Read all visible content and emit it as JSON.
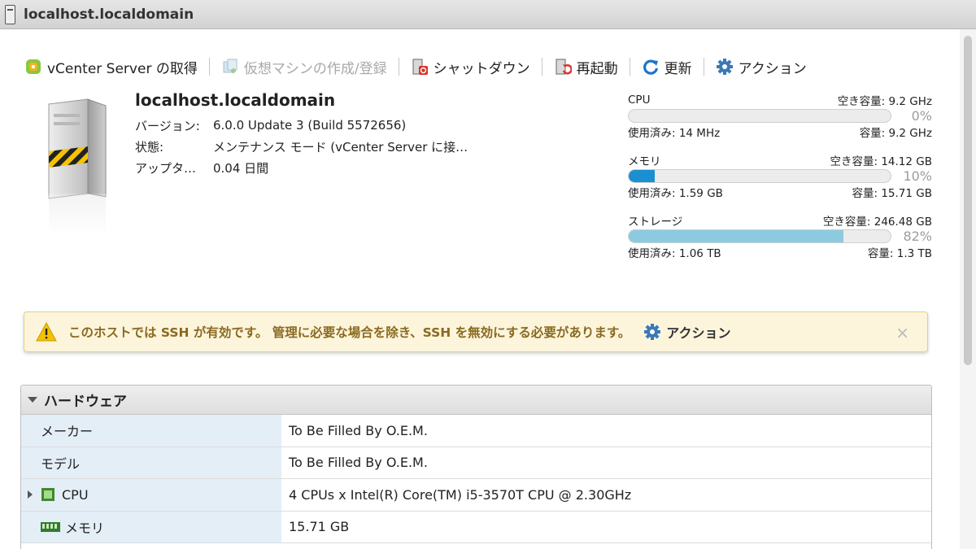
{
  "window": {
    "title": "localhost.localdomain"
  },
  "toolbar": {
    "vcenter_label": "vCenter Server の取得",
    "create_vm_label": "仮想マシンの作成/登録",
    "shutdown_label": "シャットダウン",
    "reboot_label": "再起動",
    "refresh_label": "更新",
    "actions_label": "アクション"
  },
  "host": {
    "name": "localhost.localdomain",
    "rows": [
      {
        "label": "バージョン:",
        "value": "6.0.0 Update 3 (Build 5572656)"
      },
      {
        "label": "状態:",
        "value": "メンテナンス モード (vCenter Server に接…"
      },
      {
        "label": "アップタ…",
        "value": "0.04 日間"
      }
    ]
  },
  "resources": [
    {
      "name": "CPU",
      "free": "空き容量: 9.2 GHz",
      "percent": 0,
      "percent_label": "0%",
      "used": "使用済み: 14 MHz",
      "capacity": "容量: 9.2 GHz",
      "color": "#1a8fd2"
    },
    {
      "name": "メモリ",
      "free": "空き容量: 14.12 GB",
      "percent": 10,
      "percent_label": "10%",
      "used": "使用済み: 1.59 GB",
      "capacity": "容量: 15.71 GB",
      "color": "#1a8fd2"
    },
    {
      "name": "ストレージ",
      "free": "空き容量: 246.48 GB",
      "percent": 82,
      "percent_label": "82%",
      "used": "使用済み: 1.06 TB",
      "capacity": "容量: 1.3 TB",
      "color": "#8ccbdf"
    }
  ],
  "alert": {
    "message": "このホストでは SSH が有効です。 管理に必要な場合を除き、SSH を無効にする必要があります。",
    "action_label": "アクション",
    "close": "×"
  },
  "hardware": {
    "title": "ハードウェア",
    "rows": [
      {
        "label": "メーカー",
        "value": "To Be Filled By O.E.M."
      },
      {
        "label": "モデル",
        "value": "To Be Filled By O.E.M."
      },
      {
        "label": "CPU",
        "value": "4 CPUs x Intel(R) Core(TM) i5-3570T CPU @ 2.30GHz"
      },
      {
        "label": "メモリ",
        "value": "15.71 GB"
      }
    ]
  }
}
